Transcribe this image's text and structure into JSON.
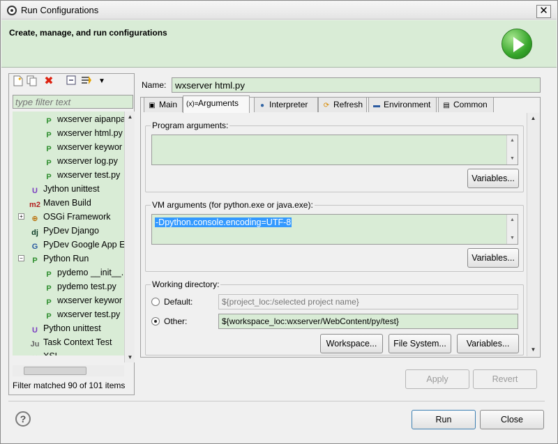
{
  "window": {
    "title": "Run Configurations",
    "close": "✕"
  },
  "header": {
    "text": "Create, manage, and run configurations"
  },
  "toolbar": {
    "new_icon": "new-config-icon",
    "duplicate_icon": "duplicate-icon",
    "delete_icon": "delete-icon",
    "collapse_icon": "collapse-all-icon",
    "filter_icon": "filter-icon",
    "menu_icon": "dropdown-menu-icon"
  },
  "filter": {
    "placeholder": "type filter text"
  },
  "tree": {
    "items": [
      {
        "label": "wxserver aipanpa",
        "indent": 2,
        "icon": "P"
      },
      {
        "label": "wxserver html.py",
        "indent": 2,
        "icon": "P"
      },
      {
        "label": "wxserver keywor",
        "indent": 2,
        "icon": "P"
      },
      {
        "label": "wxserver log.py",
        "indent": 2,
        "icon": "P"
      },
      {
        "label": "wxserver test.py",
        "indent": 2,
        "icon": "P"
      },
      {
        "label": "Jython unittest",
        "indent": 1,
        "icon": "U"
      },
      {
        "label": "Maven Build",
        "indent": 1,
        "icon": "m2"
      },
      {
        "label": "OSGi Framework",
        "indent": 1,
        "icon": "⊕"
      },
      {
        "label": "PyDev Django",
        "indent": 1,
        "icon": "dj"
      },
      {
        "label": "PyDev Google App E",
        "indent": 1,
        "icon": "G"
      },
      {
        "label": "Python Run",
        "indent": 1,
        "icon": "P"
      },
      {
        "label": "pydemo __init__.p",
        "indent": 2,
        "icon": "P"
      },
      {
        "label": "pydemo test.py",
        "indent": 2,
        "icon": "P"
      },
      {
        "label": "wxserver keywor",
        "indent": 2,
        "icon": "P"
      },
      {
        "label": "wxserver test.py",
        "indent": 2,
        "icon": "P"
      },
      {
        "label": "Python unittest",
        "indent": 1,
        "icon": "U"
      },
      {
        "label": "Task Context Test",
        "indent": 1,
        "icon": "Ju"
      },
      {
        "label": "XSL",
        "indent": 1,
        "icon": "✕"
      }
    ],
    "status": "Filter matched 90 of 101 items"
  },
  "config": {
    "name_label": "Name:",
    "name_value": "wxserver html.py",
    "tabs": [
      {
        "label": "Main",
        "icon": "main-tab-icon"
      },
      {
        "label": "Arguments",
        "icon": "arguments-tab-icon"
      },
      {
        "label": "Interpreter",
        "icon": "interpreter-tab-icon"
      },
      {
        "label": "Refresh",
        "icon": "refresh-tab-icon"
      },
      {
        "label": "Environment",
        "icon": "environment-tab-icon"
      },
      {
        "label": "Common",
        "icon": "common-tab-icon"
      }
    ],
    "program_args": {
      "title": "Program arguments:",
      "value": "",
      "variables": "Variables..."
    },
    "vm_args": {
      "title": "VM arguments (for python.exe or java.exe):",
      "value": "-Dpython.console.encoding=UTF-8",
      "variables": "Variables..."
    },
    "workdir": {
      "title": "Working directory:",
      "default_label": "Default:",
      "default_value": "${project_loc:/selected project name}",
      "other_label": "Other:",
      "other_value": "${workspace_loc:wxserver/WebContent/py/test}",
      "workspace_btn": "Workspace...",
      "filesystem_btn": "File System...",
      "variables_btn": "Variables..."
    }
  },
  "actions": {
    "apply": "Apply",
    "revert": "Revert",
    "run": "Run",
    "close": "Close",
    "help": "?"
  }
}
